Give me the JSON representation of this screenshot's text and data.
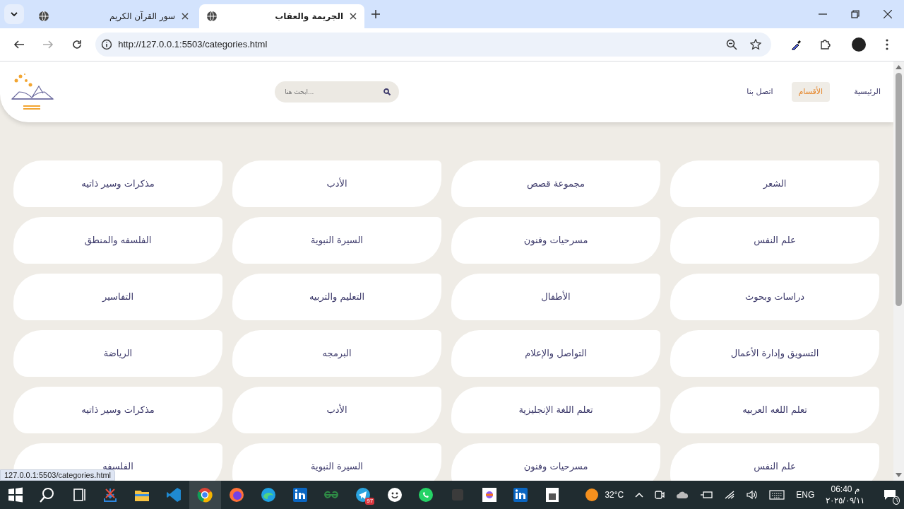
{
  "browser": {
    "tabs": [
      {
        "title": "الجريمة والعقاب",
        "selected": true
      },
      {
        "title": "سور القرآن الكريم",
        "selected": false
      }
    ],
    "url": "http://127.0.0.1:5503/categories.html",
    "status_url": "127.0.0.1:5503/categories.html"
  },
  "header": {
    "nav": [
      {
        "label": "الرئيسية",
        "selected": false
      },
      {
        "label": "الأقسام",
        "selected": true
      },
      {
        "label": "اتصل بنا",
        "selected": false
      }
    ],
    "search": {
      "placeholder": "...ابحث هنا"
    }
  },
  "categories": [
    "الشعر",
    "مجموعة قصص",
    "الأدب",
    "مذكرات وسير ذاتيه",
    "علم النفس",
    "مسرحيات وفنون",
    "السيرة النبوية",
    "الفلسفه والمنطق",
    "دراسات وبحوث",
    "الأطفال",
    "التعليم والتربيه",
    "التفاسير",
    "التسويق وإدارة الأعمال",
    "التواصل والإعلام",
    "البرمجه",
    "الرياضة",
    "تعلم اللغه العربيه",
    "تعلم اللغة الإنجليزية",
    "الأدب",
    "مذكرات وسير ذاتيه",
    "علم النفس",
    "مسرحيات وفنون",
    "السيرة النبوية",
    "الفلسفه"
  ],
  "taskbar": {
    "telegram_badge": "97",
    "weather": "32°C",
    "language": "ENG",
    "time": "م 06:40",
    "date": "٢٠٢٥/٠٩/١١",
    "notification_badge": "٦"
  }
}
